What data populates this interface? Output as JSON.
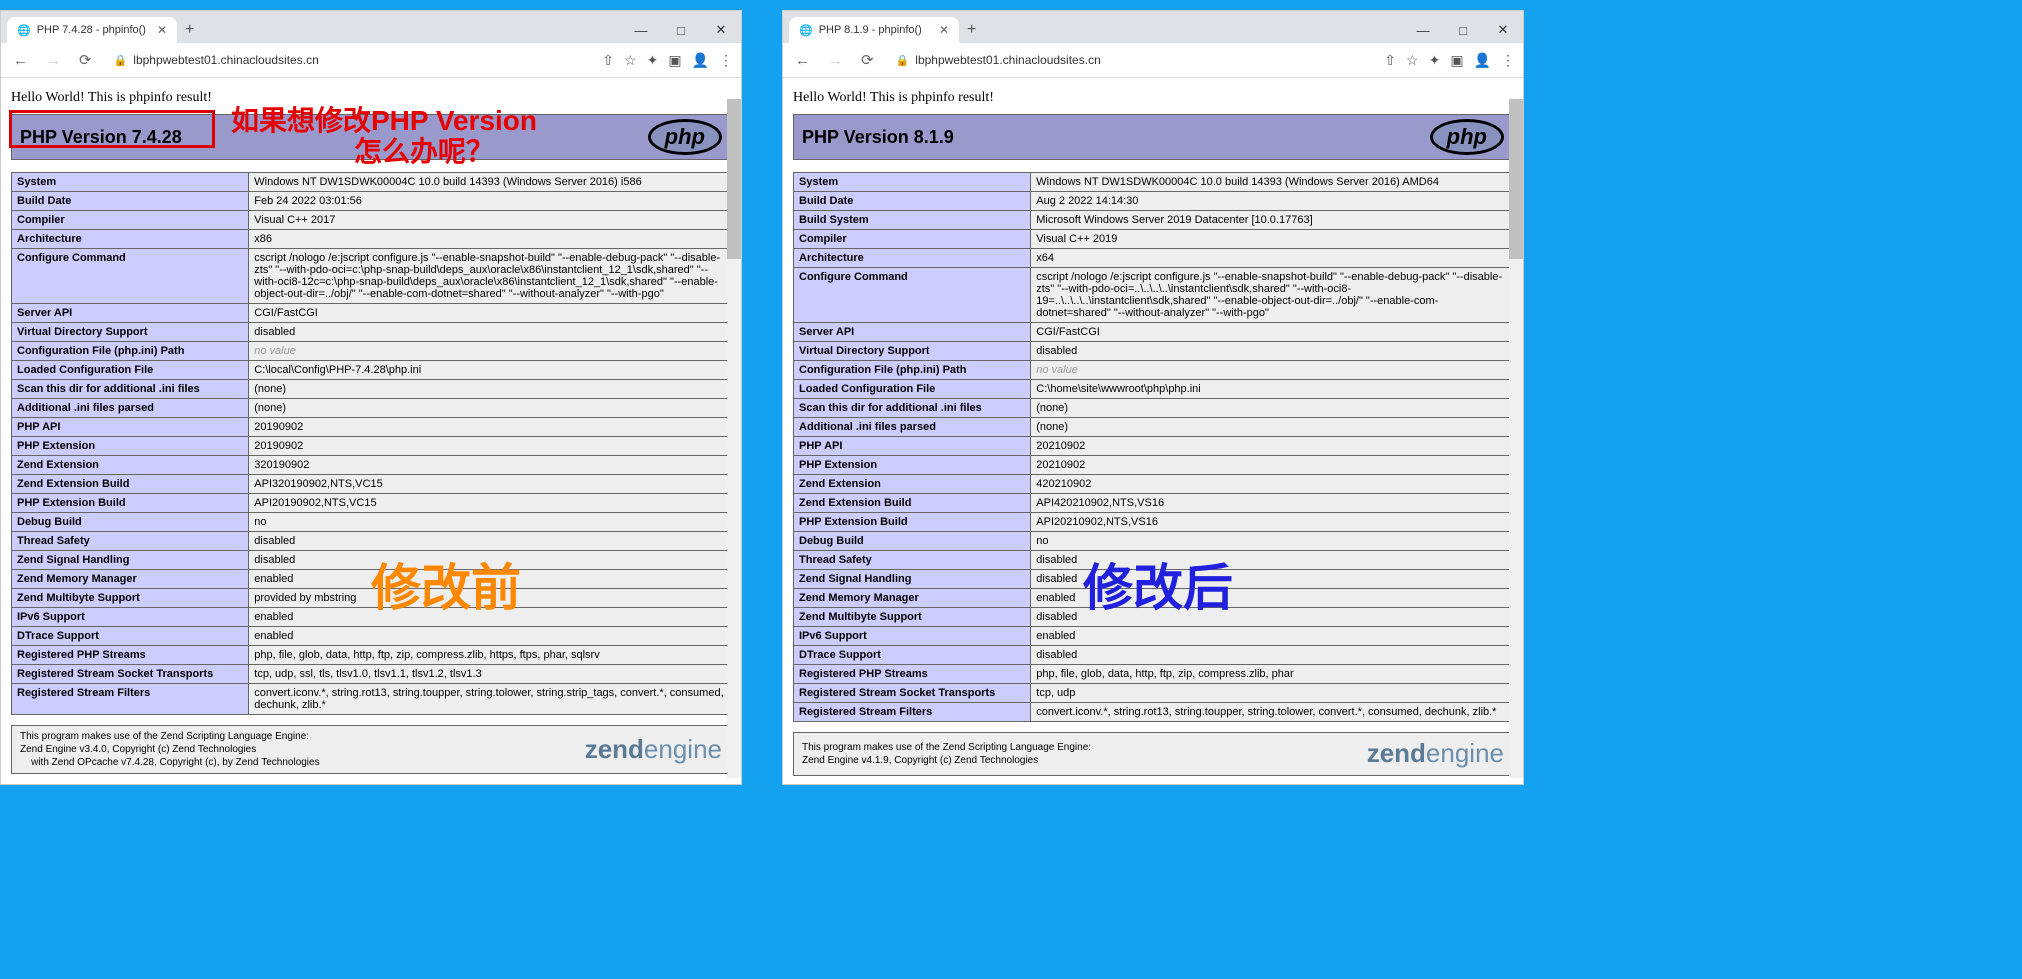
{
  "left": {
    "tab_title": "PHP 7.4.28 - phpinfo()",
    "url": "lbphpwebtest01.chinacloudsites.cn",
    "hello": "Hello World! This is phpinfo result!",
    "php_version": "PHP Version 7.4.28",
    "annotation_line1": "如果想修改PHP Version",
    "annotation_line2": "怎么办呢？",
    "rows": [
      {
        "k": "System",
        "v": "Windows NT DW1SDWK00004C 10.0 build 14393 (Windows Server 2016) i586"
      },
      {
        "k": "Build Date",
        "v": "Feb 24 2022 03:01:56"
      },
      {
        "k": "Compiler",
        "v": "Visual C++ 2017"
      },
      {
        "k": "Architecture",
        "v": "x86"
      },
      {
        "k": "Configure Command",
        "v": "cscript /nologo /e:jscript configure.js \"--enable-snapshot-build\" \"--enable-debug-pack\" \"--disable-zts\" \"--with-pdo-oci=c:\\php-snap-build\\deps_aux\\oracle\\x86\\instantclient_12_1\\sdk,shared\" \"--with-oci8-12c=c:\\php-snap-build\\deps_aux\\oracle\\x86\\instantclient_12_1\\sdk,shared\" \"--enable-object-out-dir=../obj/\" \"--enable-com-dotnet=shared\" \"--without-analyzer\" \"--with-pgo\""
      },
      {
        "k": "Server API",
        "v": "CGI/FastCGI"
      },
      {
        "k": "Virtual Directory Support",
        "v": "disabled"
      },
      {
        "k": "Configuration File (php.ini) Path",
        "v": "no value",
        "novalue": true
      },
      {
        "k": "Loaded Configuration File",
        "v": "C:\\local\\Config\\PHP-7.4.28\\php.ini"
      },
      {
        "k": "Scan this dir for additional .ini files",
        "v": "(none)"
      },
      {
        "k": "Additional .ini files parsed",
        "v": "(none)"
      },
      {
        "k": "PHP API",
        "v": "20190902"
      },
      {
        "k": "PHP Extension",
        "v": "20190902"
      },
      {
        "k": "Zend Extension",
        "v": "320190902"
      },
      {
        "k": "Zend Extension Build",
        "v": "API320190902,NTS,VC15"
      },
      {
        "k": "PHP Extension Build",
        "v": "API20190902,NTS,VC15"
      },
      {
        "k": "Debug Build",
        "v": "no"
      },
      {
        "k": "Thread Safety",
        "v": "disabled"
      },
      {
        "k": "Zend Signal Handling",
        "v": "disabled"
      },
      {
        "k": "Zend Memory Manager",
        "v": "enabled"
      },
      {
        "k": "Zend Multibyte Support",
        "v": "provided by mbstring"
      },
      {
        "k": "IPv6 Support",
        "v": "enabled"
      },
      {
        "k": "DTrace Support",
        "v": "enabled"
      },
      {
        "k": "Registered PHP Streams",
        "v": "php, file, glob, data, http, ftp, zip, compress.zlib, https, ftps, phar, sqlsrv"
      },
      {
        "k": "Registered Stream Socket Transports",
        "v": "tcp, udp, ssl, tls, tlsv1.0, tlsv1.1, tlsv1.2, tlsv1.3"
      },
      {
        "k": "Registered Stream Filters",
        "v": "convert.iconv.*, string.rot13, string.toupper, string.tolower, string.strip_tags, convert.*, consumed, dechunk, zlib.*"
      }
    ],
    "footer_lines": [
      "This program makes use of the Zend Scripting Language Engine:",
      "Zend Engine v3.4.0, Copyright (c) Zend Technologies",
      "    with Zend OPcache v7.4.28, Copyright (c), by Zend Technologies"
    ],
    "overlay": "修改前"
  },
  "right": {
    "tab_title": "PHP 8.1.9 - phpinfo()",
    "url": "lbphpwebtest01.chinacloudsites.cn",
    "hello": "Hello World! This is phpinfo result!",
    "php_version": "PHP Version 8.1.9",
    "rows": [
      {
        "k": "System",
        "v": "Windows NT DW1SDWK00004C 10.0 build 14393 (Windows Server 2016) AMD64"
      },
      {
        "k": "Build Date",
        "v": "Aug 2 2022 14:14:30"
      },
      {
        "k": "Build System",
        "v": "Microsoft Windows Server 2019 Datacenter [10.0.17763]"
      },
      {
        "k": "Compiler",
        "v": "Visual C++ 2019"
      },
      {
        "k": "Architecture",
        "v": "x64"
      },
      {
        "k": "Configure Command",
        "v": "cscript /nologo /e:jscript configure.js \"--enable-snapshot-build\" \"--enable-debug-pack\" \"--disable-zts\" \"--with-pdo-oci=..\\..\\..\\..\\instantclient\\sdk,shared\" \"--with-oci8-19=..\\..\\..\\..\\instantclient\\sdk,shared\" \"--enable-object-out-dir=../obj/\" \"--enable-com-dotnet=shared\" \"--without-analyzer\" \"--with-pgo\""
      },
      {
        "k": "Server API",
        "v": "CGI/FastCGI"
      },
      {
        "k": "Virtual Directory Support",
        "v": "disabled"
      },
      {
        "k": "Configuration File (php.ini) Path",
        "v": "no value",
        "novalue": true
      },
      {
        "k": "Loaded Configuration File",
        "v": "C:\\home\\site\\wwwroot\\php\\php.ini"
      },
      {
        "k": "Scan this dir for additional .ini files",
        "v": "(none)"
      },
      {
        "k": "Additional .ini files parsed",
        "v": "(none)"
      },
      {
        "k": "PHP API",
        "v": "20210902"
      },
      {
        "k": "PHP Extension",
        "v": "20210902"
      },
      {
        "k": "Zend Extension",
        "v": "420210902"
      },
      {
        "k": "Zend Extension Build",
        "v": "API420210902,NTS,VS16"
      },
      {
        "k": "PHP Extension Build",
        "v": "API20210902,NTS,VS16"
      },
      {
        "k": "Debug Build",
        "v": "no"
      },
      {
        "k": "Thread Safety",
        "v": "disabled"
      },
      {
        "k": "Zend Signal Handling",
        "v": "disabled"
      },
      {
        "k": "Zend Memory Manager",
        "v": "enabled"
      },
      {
        "k": "Zend Multibyte Support",
        "v": "disabled"
      },
      {
        "k": "IPv6 Support",
        "v": "enabled"
      },
      {
        "k": "DTrace Support",
        "v": "disabled"
      },
      {
        "k": "Registered PHP Streams",
        "v": "php, file, glob, data, http, ftp, zip, compress.zlib, phar"
      },
      {
        "k": "Registered Stream Socket Transports",
        "v": "tcp, udp"
      },
      {
        "k": "Registered Stream Filters",
        "v": "convert.iconv.*, string.rot13, string.toupper, string.tolower, convert.*, consumed, dechunk, zlib.*"
      }
    ],
    "footer_lines": [
      "This program makes use of the Zend Scripting Language Engine:",
      "Zend Engine v4.1.9, Copyright (c) Zend Technologies"
    ],
    "overlay": "修改后"
  },
  "logo_text": "php",
  "zend_text_a": "zend",
  "zend_text_b": "engine"
}
